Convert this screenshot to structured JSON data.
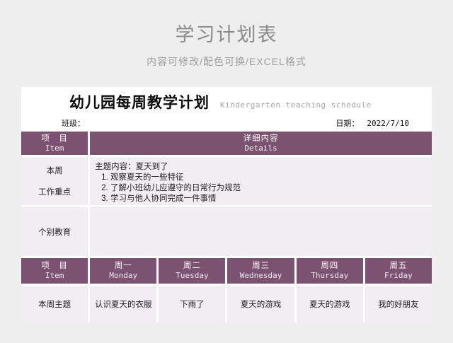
{
  "page": {
    "title": "学习计划表",
    "subtitle": "内容可修改/配色可换/EXCEL格式"
  },
  "card": {
    "title": "幼儿园每周教学计划",
    "title_en": "Kindergarten teaching schedule",
    "class_label": "班级：",
    "date_label": "日期：",
    "date_value": "2022/7/10"
  },
  "top_table": {
    "header_item_zh": "项　目",
    "header_item_en": "Item",
    "header_details_zh": "详细内容",
    "header_details_en": "Details",
    "rows": [
      {
        "label_lines": [
          "本周",
          "工作重点"
        ],
        "content_lines": [
          "主题内容：夏天到了",
          "1. 观察夏天的一些特征",
          "2. 了解小班幼儿应遵守的日常行为规范",
          "3. 学习与他人协同完成一件事情"
        ]
      },
      {
        "label_lines": [
          "个别教育"
        ],
        "content_lines": []
      }
    ]
  },
  "week_table": {
    "headers": [
      {
        "zh": "项　目",
        "en": "Item"
      },
      {
        "zh": "周一",
        "en": "Monday"
      },
      {
        "zh": "周二",
        "en": "Tuesday"
      },
      {
        "zh": "周三",
        "en": "Wednesday"
      },
      {
        "zh": "周四",
        "en": "Thursday"
      },
      {
        "zh": "周五",
        "en": "Friday"
      }
    ],
    "row_label": "本周主题",
    "row_values": [
      "认识夏天的衣服",
      "下雨了",
      "夏天的游戏",
      "夏天的游戏",
      "我的好朋友"
    ]
  },
  "colors": {
    "accent_purple": "#7c5271",
    "cell_bg": "#f2edf2",
    "grid_line": "#ffffff",
    "page_bg": "#efeeef",
    "title_gray": "#8b8b8b"
  }
}
